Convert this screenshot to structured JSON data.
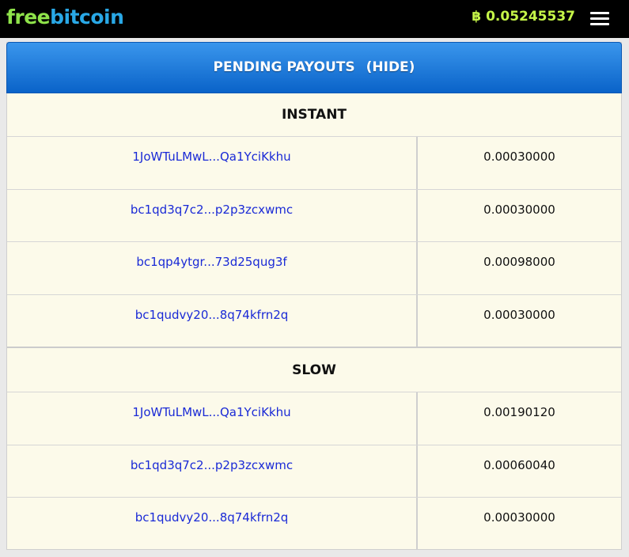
{
  "header": {
    "logo_free": "free",
    "logo_bitcoin": "bitcoin",
    "balance_icon": "฿",
    "balance": "0.05245537"
  },
  "panel": {
    "title": "PENDING PAYOUTS",
    "hide_label": "(HIDE)"
  },
  "instant": {
    "title": "INSTANT",
    "rows": [
      {
        "address": "1JoWTuLMwL...Qa1YciKkhu",
        "amount": "0.00030000"
      },
      {
        "address": "bc1qd3q7c2...p2p3zcxwmc",
        "amount": "0.00030000"
      },
      {
        "address": "bc1qp4ytgr...73d25qug3f",
        "amount": "0.00098000"
      },
      {
        "address": "bc1qudvy20...8q74kfrn2q",
        "amount": "0.00030000"
      }
    ]
  },
  "slow": {
    "title": "SLOW",
    "rows": [
      {
        "address": "1JoWTuLMwL...Qa1YciKkhu",
        "amount": "0.00190120"
      },
      {
        "address": "bc1qd3q7c2...p2p3zcxwmc",
        "amount": "0.00060040"
      },
      {
        "address": "bc1qudvy20...8q74kfrn2q",
        "amount": "0.00030000"
      }
    ]
  },
  "colors": {
    "accent_blue": "#0a63c9",
    "link_blue": "#1a2ad6",
    "balance_green": "#c5f548",
    "panel_bg": "#fcfaea"
  }
}
